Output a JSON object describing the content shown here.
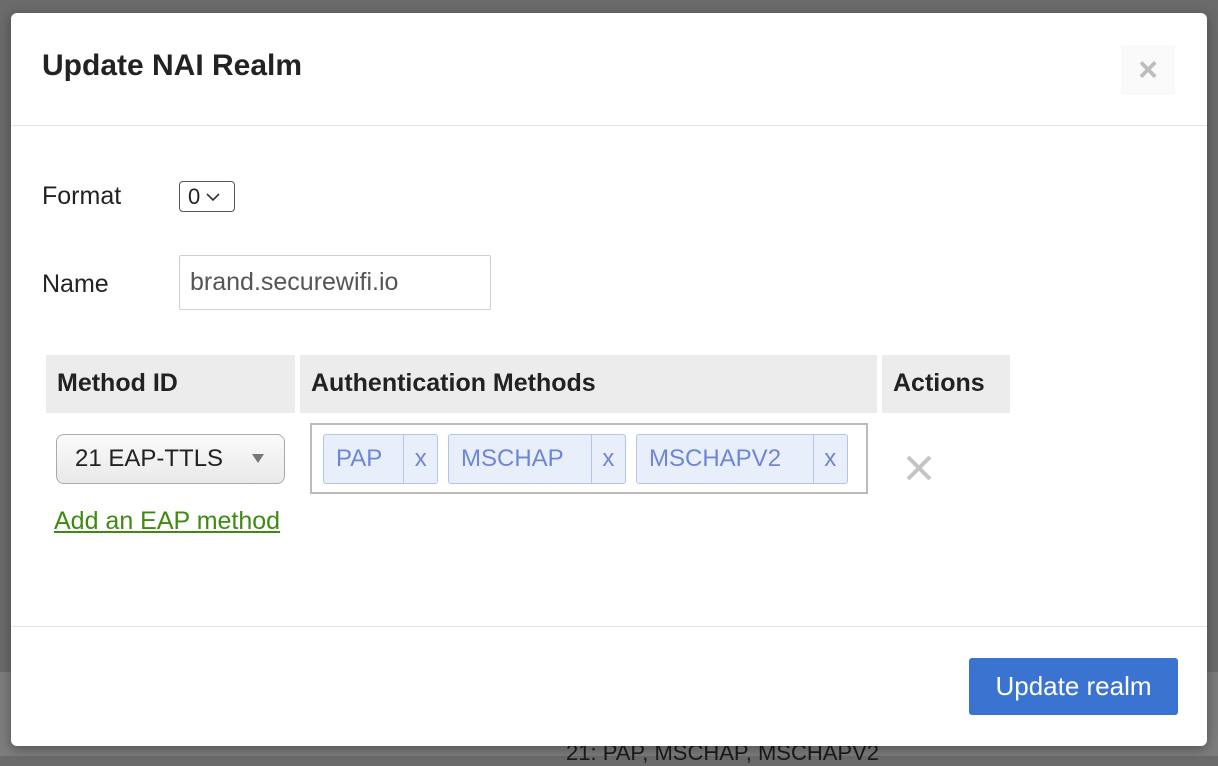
{
  "dialog": {
    "title": "Update NAI Realm",
    "close_label": "×"
  },
  "form": {
    "format_label": "Format",
    "format_value": "0",
    "name_label": "Name",
    "name_value": "brand.securewifi.io"
  },
  "table": {
    "headers": [
      "Method ID",
      "Authentication Methods",
      "Actions"
    ],
    "rows": [
      {
        "method_id": "21 EAP-TTLS",
        "auth_methods": [
          {
            "label": "PAP",
            "remove": "x"
          },
          {
            "label": "MSCHAP",
            "remove": "x"
          },
          {
            "label": "MSCHAPV2",
            "remove": "x"
          }
        ]
      }
    ]
  },
  "add_method_link": "Add an EAP method",
  "footer": {
    "update_button": "Update realm"
  },
  "background": {
    "partial_text": "21: PAP, MSCHAP, MSCHAPV2"
  },
  "colors": {
    "primary_button": "#3b74d0",
    "link": "#3e8a10",
    "tag_text": "#6e86d6",
    "tag_bg": "#e8eefa"
  },
  "icons": {
    "close": "close-icon",
    "select_arrow": "chevron-down-icon",
    "delete_row": "delete-icon"
  }
}
